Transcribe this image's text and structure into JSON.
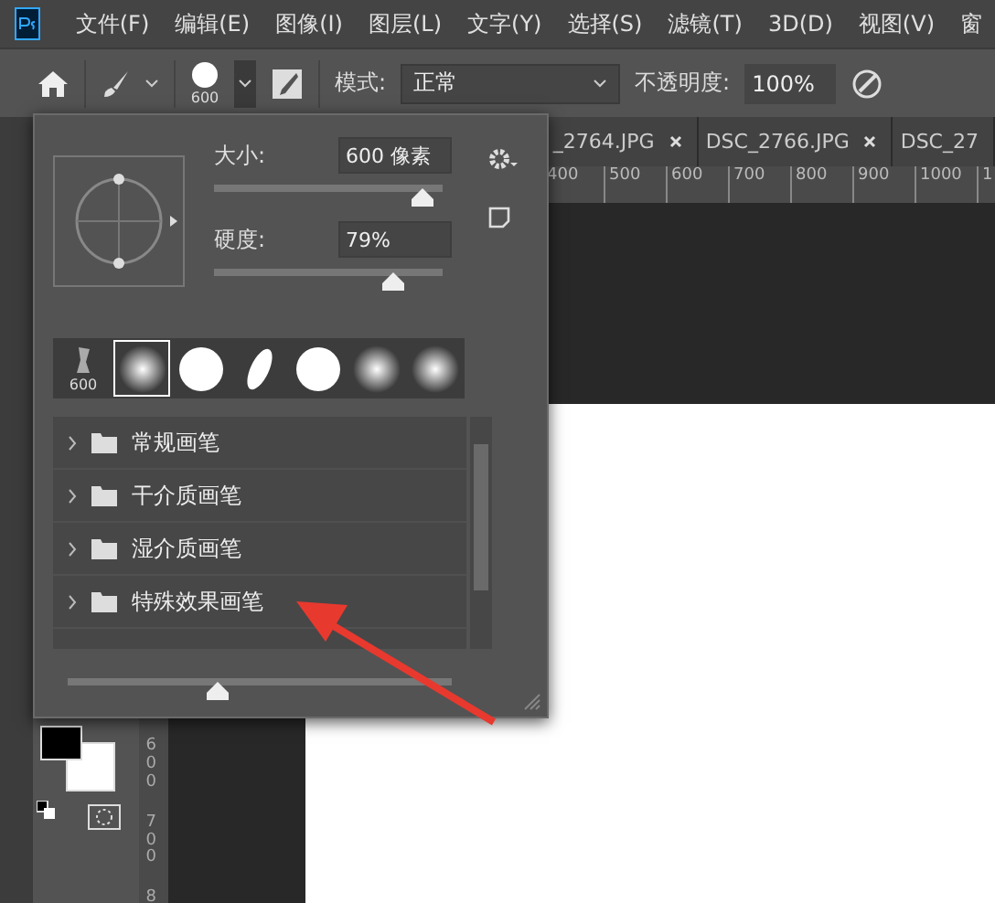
{
  "menu": [
    "文件(F)",
    "编辑(E)",
    "图像(I)",
    "图层(L)",
    "文字(Y)",
    "选择(S)",
    "滤镜(T)",
    "3D(D)",
    "视图(V)",
    "窗"
  ],
  "options": {
    "brush_size": "600",
    "mode_label": "模式:",
    "mode": "正常",
    "opacity_label": "不透明度:",
    "opacity": "100%"
  },
  "tabs": [
    {
      "label": "_2764.JPG"
    },
    {
      "label": "DSC_2766.JPG"
    },
    {
      "label": "DSC_27"
    }
  ],
  "ruler_h": [
    "400",
    "500",
    "600",
    "700",
    "800",
    "900",
    "1000",
    "1"
  ],
  "ruler_v": [
    "600",
    "700",
    "8"
  ],
  "brush_panel": {
    "sliders": [
      {
        "label": "大小:",
        "value": "600 像素",
        "level": 0.91
      },
      {
        "label": "硬度:",
        "value": "79%",
        "level": 0.78
      }
    ],
    "presets": [
      {
        "kind": "sampled",
        "label": "600",
        "selected": false
      },
      {
        "kind": "soft",
        "selected": true
      },
      {
        "kind": "hard",
        "selected": false
      },
      {
        "kind": "ellipse",
        "selected": false
      },
      {
        "kind": "hard",
        "selected": false
      },
      {
        "kind": "soft",
        "selected": false
      },
      {
        "kind": "soft",
        "selected": false
      }
    ],
    "groups": [
      {
        "label": "常规画笔"
      },
      {
        "label": "干介质画笔"
      },
      {
        "label": "湿介质画笔"
      },
      {
        "label": "特殊效果画笔"
      }
    ],
    "preview_size": {
      "level": 0.39
    }
  }
}
